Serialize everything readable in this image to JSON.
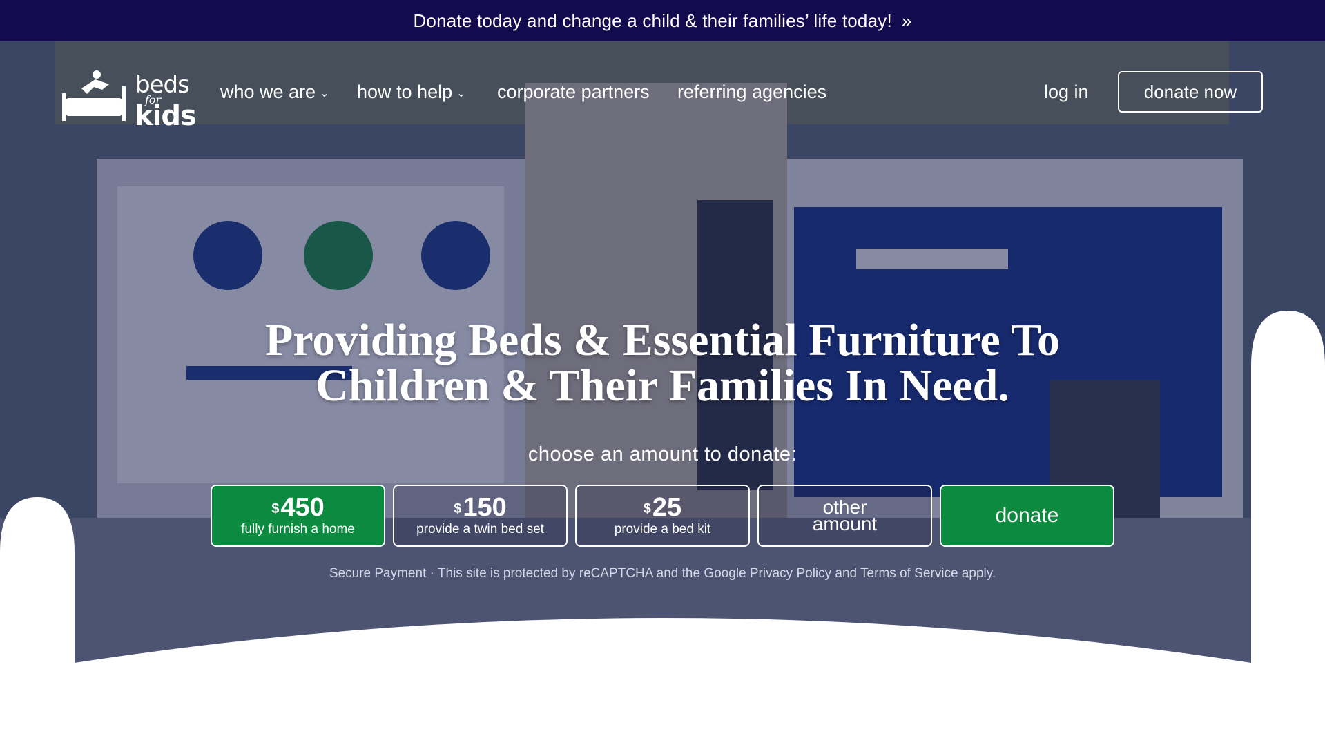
{
  "announcement": {
    "text": "Donate today and change a child & their families’ life today!",
    "arrow": "»"
  },
  "logo": {
    "beds": "beds",
    "for": "for",
    "kids": "kids",
    "icon": "bed-jumper-icon"
  },
  "nav": {
    "items": [
      {
        "label": "who we are",
        "has_dropdown": true
      },
      {
        "label": "how to help",
        "has_dropdown": true
      },
      {
        "label": "corporate partners",
        "has_dropdown": false
      },
      {
        "label": "referring agencies",
        "has_dropdown": false
      }
    ],
    "login": "log in",
    "donate_now": "donate now"
  },
  "hero": {
    "headline_line1": "Providing Beds & Essential Furniture To",
    "headline_line2": "Children & Their Families In Need.",
    "choose_label": "choose an amount to donate:",
    "amounts": [
      {
        "currency": "$",
        "value": "450",
        "desc": "fully furnish a home",
        "selected": true
      },
      {
        "currency": "$",
        "value": "150",
        "desc": "provide a twin bed set",
        "selected": false
      },
      {
        "currency": "$",
        "value": "25",
        "desc": "provide a bed kit",
        "selected": false
      }
    ],
    "other_line1": "other",
    "other_line2": "amount",
    "donate_button": "donate",
    "secure_text": "Secure Payment · This site is protected by reCAPTCHA and the Google Privacy Policy and Terms of Service apply."
  },
  "colors": {
    "banner": "#140b4f",
    "accent_green": "#0c8a3f",
    "overlay": "#141846"
  }
}
